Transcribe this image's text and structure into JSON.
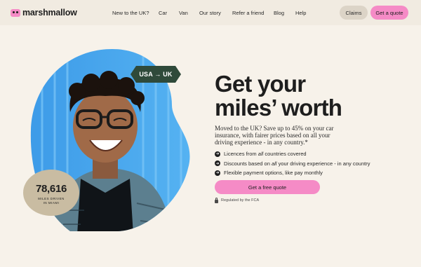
{
  "brand": {
    "name": "marshmallow",
    "accent": "#f58bc6",
    "dark": "#1e1e1e",
    "green": "#2f4a3a",
    "badge_bg": "#c9bca2"
  },
  "nav": {
    "items": [
      "New to the UK?",
      "Car",
      "Van",
      "Our story",
      "Refer a friend",
      "Blog",
      "Help"
    ],
    "claims_label": "Claims",
    "quote_label": "Get a quote"
  },
  "hero": {
    "route_badge": "USA → UK",
    "stat_number": "78,616",
    "stat_label_1": "MILES DRIVEN",
    "stat_label_2": "IN MIAMI",
    "headline_1": "Get your",
    "headline_2": "miles’ worth",
    "subtext": "Moved to the UK? Save up to 45% on your car insurance, with fairer prices based on all your driving experience - in any country.*",
    "features": [
      {
        "pre": "Licences from ",
        "em": "all",
        "post": " countries covered"
      },
      {
        "pre": "Discounts based on ",
        "em": "all",
        "post": " your driving experience - in any country"
      },
      {
        "pre": "Flexible payment options, like pay monthly",
        "em": "",
        "post": ""
      }
    ],
    "cta_label": "Get a free quote",
    "regulated": "Regulated by the FCA"
  }
}
